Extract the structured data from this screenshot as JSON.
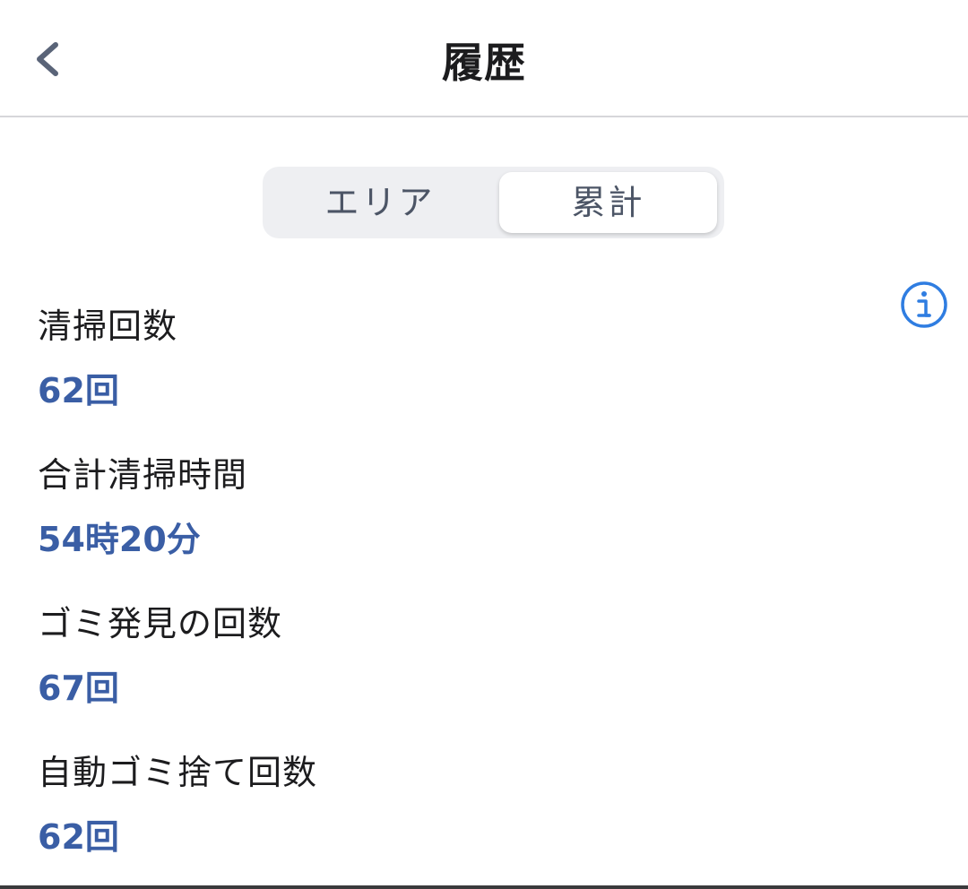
{
  "nav": {
    "title": "履歴",
    "back_icon": "chevron-left-icon"
  },
  "segmented": {
    "options": [
      "エリア",
      "累計"
    ],
    "selected": "累計"
  },
  "info_icon": "info-circle-icon",
  "stats": [
    {
      "label": "清掃回数",
      "value": "62回"
    },
    {
      "label": "合計清掃時間",
      "value": "54時20分"
    },
    {
      "label": "ゴミ発見の回数",
      "value": "67回"
    },
    {
      "label": "自動ゴミ捨て回数",
      "value": "62回"
    }
  ],
  "colors": {
    "accent_value": "#3a5ea5",
    "info_icon": "#2f7de1",
    "back_chevron": "#5a6478"
  }
}
